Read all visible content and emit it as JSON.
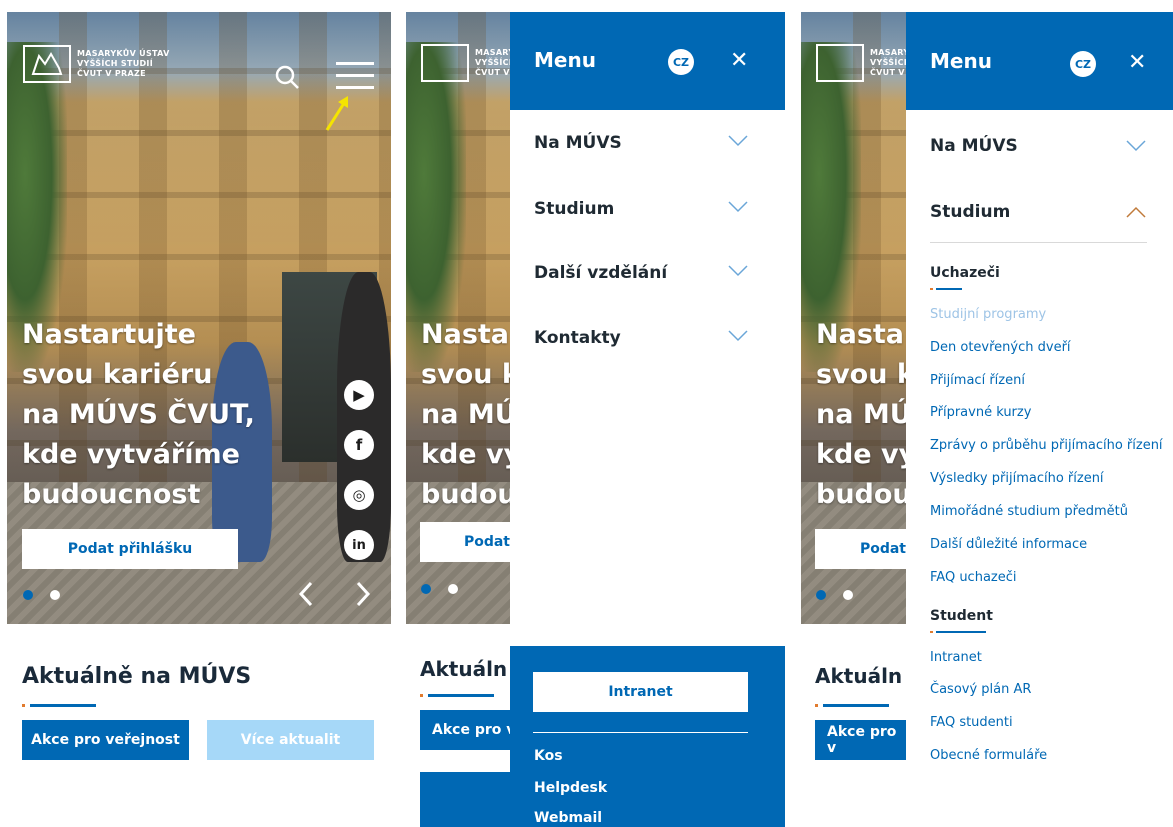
{
  "logo": {
    "line1": "MASARYKŮV ÚSTAV",
    "line2": "VYŠŠÍCH STUDIÍ",
    "line3": "ČVUT V PRAZE"
  },
  "hero": {
    "title_lines": [
      "Nastartujte",
      "svou kariéru",
      "na MÚVS ČVUT,",
      "kde vytváříme",
      "budoucnost"
    ],
    "apply_label": "Podat přihlášku",
    "partial_title_lines": [
      "Nasta",
      "svou k",
      "na MÚ",
      "kde vy",
      "budou"
    ],
    "partial_apply_label": "Podat"
  },
  "social": {
    "youtube": "▶",
    "facebook": "f",
    "instagram": "◎",
    "linkedin": "in"
  },
  "news": {
    "title": "Aktuálně na MÚVS",
    "partial_title": "Aktuáln",
    "events_label": "Akce pro veřejnost",
    "partial_events_label": "Akce pro v",
    "more_label": "Více aktualit"
  },
  "menu": {
    "title": "Menu",
    "lang": "CZ",
    "close": "✕",
    "items": [
      "Na MÚVS",
      "Studium",
      "Další vzdělání",
      "Kontakty"
    ],
    "intranet_label": "Intranet",
    "footer_links": [
      "Kos",
      "Helpdesk",
      "Webmail"
    ]
  },
  "submenu": {
    "applicants_heading": "Uchazeči",
    "applicants": [
      "Studijní programy",
      "Den otevřených dveří",
      "Přijímací řízení",
      "Přípravné kurzy",
      "Zprávy o průběhu přijímacího řízení",
      "Výsledky přijímacího řízení",
      "Mimořádné studium předmětů",
      "Další důležité informace",
      "FAQ uchazeči"
    ],
    "students_heading": "Student",
    "students": [
      "Intranet",
      "Časový plán AR",
      "FAQ studenti",
      "Obecné formuláře"
    ]
  },
  "colors": {
    "brand": "#0068b4",
    "brand_light": "#9ed2f5",
    "accent": "#e17b2e",
    "annotation": "#f5e400"
  }
}
